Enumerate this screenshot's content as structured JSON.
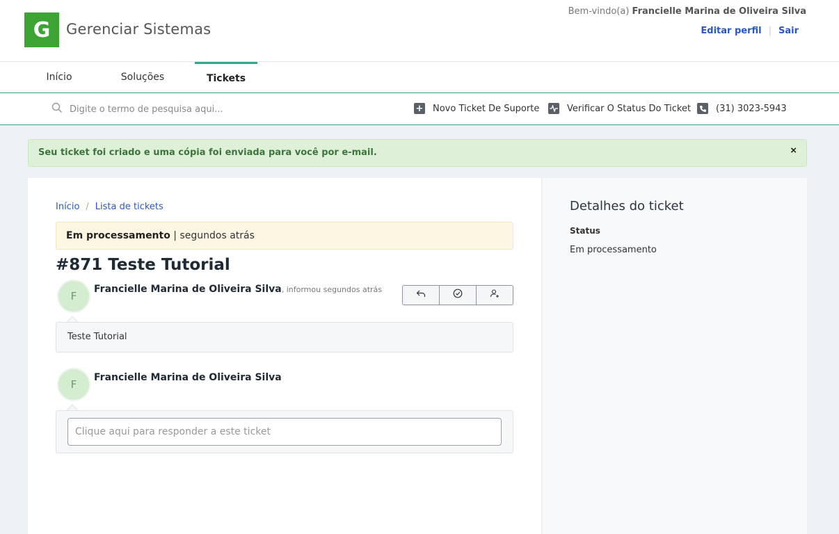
{
  "header": {
    "logo_letter": "G",
    "brand": "Gerenciar Sistemas",
    "welcome_prefix": "Bem-vindo(a)",
    "user_name": "Francielle Marina de Oliveira Silva",
    "edit_profile": "Editar perfil",
    "separator": "|",
    "logout": "Sair",
    "brand_color": "#3ba432",
    "link_color": "#2a57c8"
  },
  "nav": {
    "items": [
      {
        "label": "Início",
        "active": false
      },
      {
        "label": "Soluções",
        "active": false
      },
      {
        "label": "Tickets",
        "active": true
      }
    ],
    "accent_color": "#2fa88a"
  },
  "search": {
    "placeholder": "Digite o termo de pesquisa aqui...",
    "icon": "search-icon"
  },
  "quick_links": [
    {
      "label": "Novo Ticket De Suporte",
      "icon": "plus-square-icon"
    },
    {
      "label": "Verificar O Status Do Ticket",
      "icon": "pulse-icon"
    },
    {
      "label": "(31) 3023-5943",
      "icon": "phone-icon"
    }
  ],
  "alert": {
    "message": "Seu ticket foi criado e uma cópia foi enviada para você por e-mail.",
    "close": "×",
    "color": "#3c763d"
  },
  "breadcrumb": {
    "home": "Início",
    "separator": "/",
    "list": "Lista de tickets"
  },
  "ticket": {
    "status_label": "Em processamento",
    "status_sep": "|",
    "status_time": "segundos atrás",
    "title": "#871 Teste Tutorial",
    "post": {
      "avatar_initial": "F",
      "author": "Francielle Marina de Oliveira Silva",
      "meta": ", informou segundos atrás",
      "body": "Teste Tutorial"
    },
    "actions": [
      {
        "icon": "reply-icon"
      },
      {
        "icon": "check-circle-icon"
      },
      {
        "icon": "user-assign-icon"
      }
    ],
    "reply": {
      "avatar_initial": "F",
      "author": "Francielle Marina de Oliveira Silva",
      "placeholder": "Clique aqui para responder a este ticket"
    }
  },
  "details": {
    "title": "Detalhes do ticket",
    "status_label": "Status",
    "status_value": "Em processamento"
  }
}
